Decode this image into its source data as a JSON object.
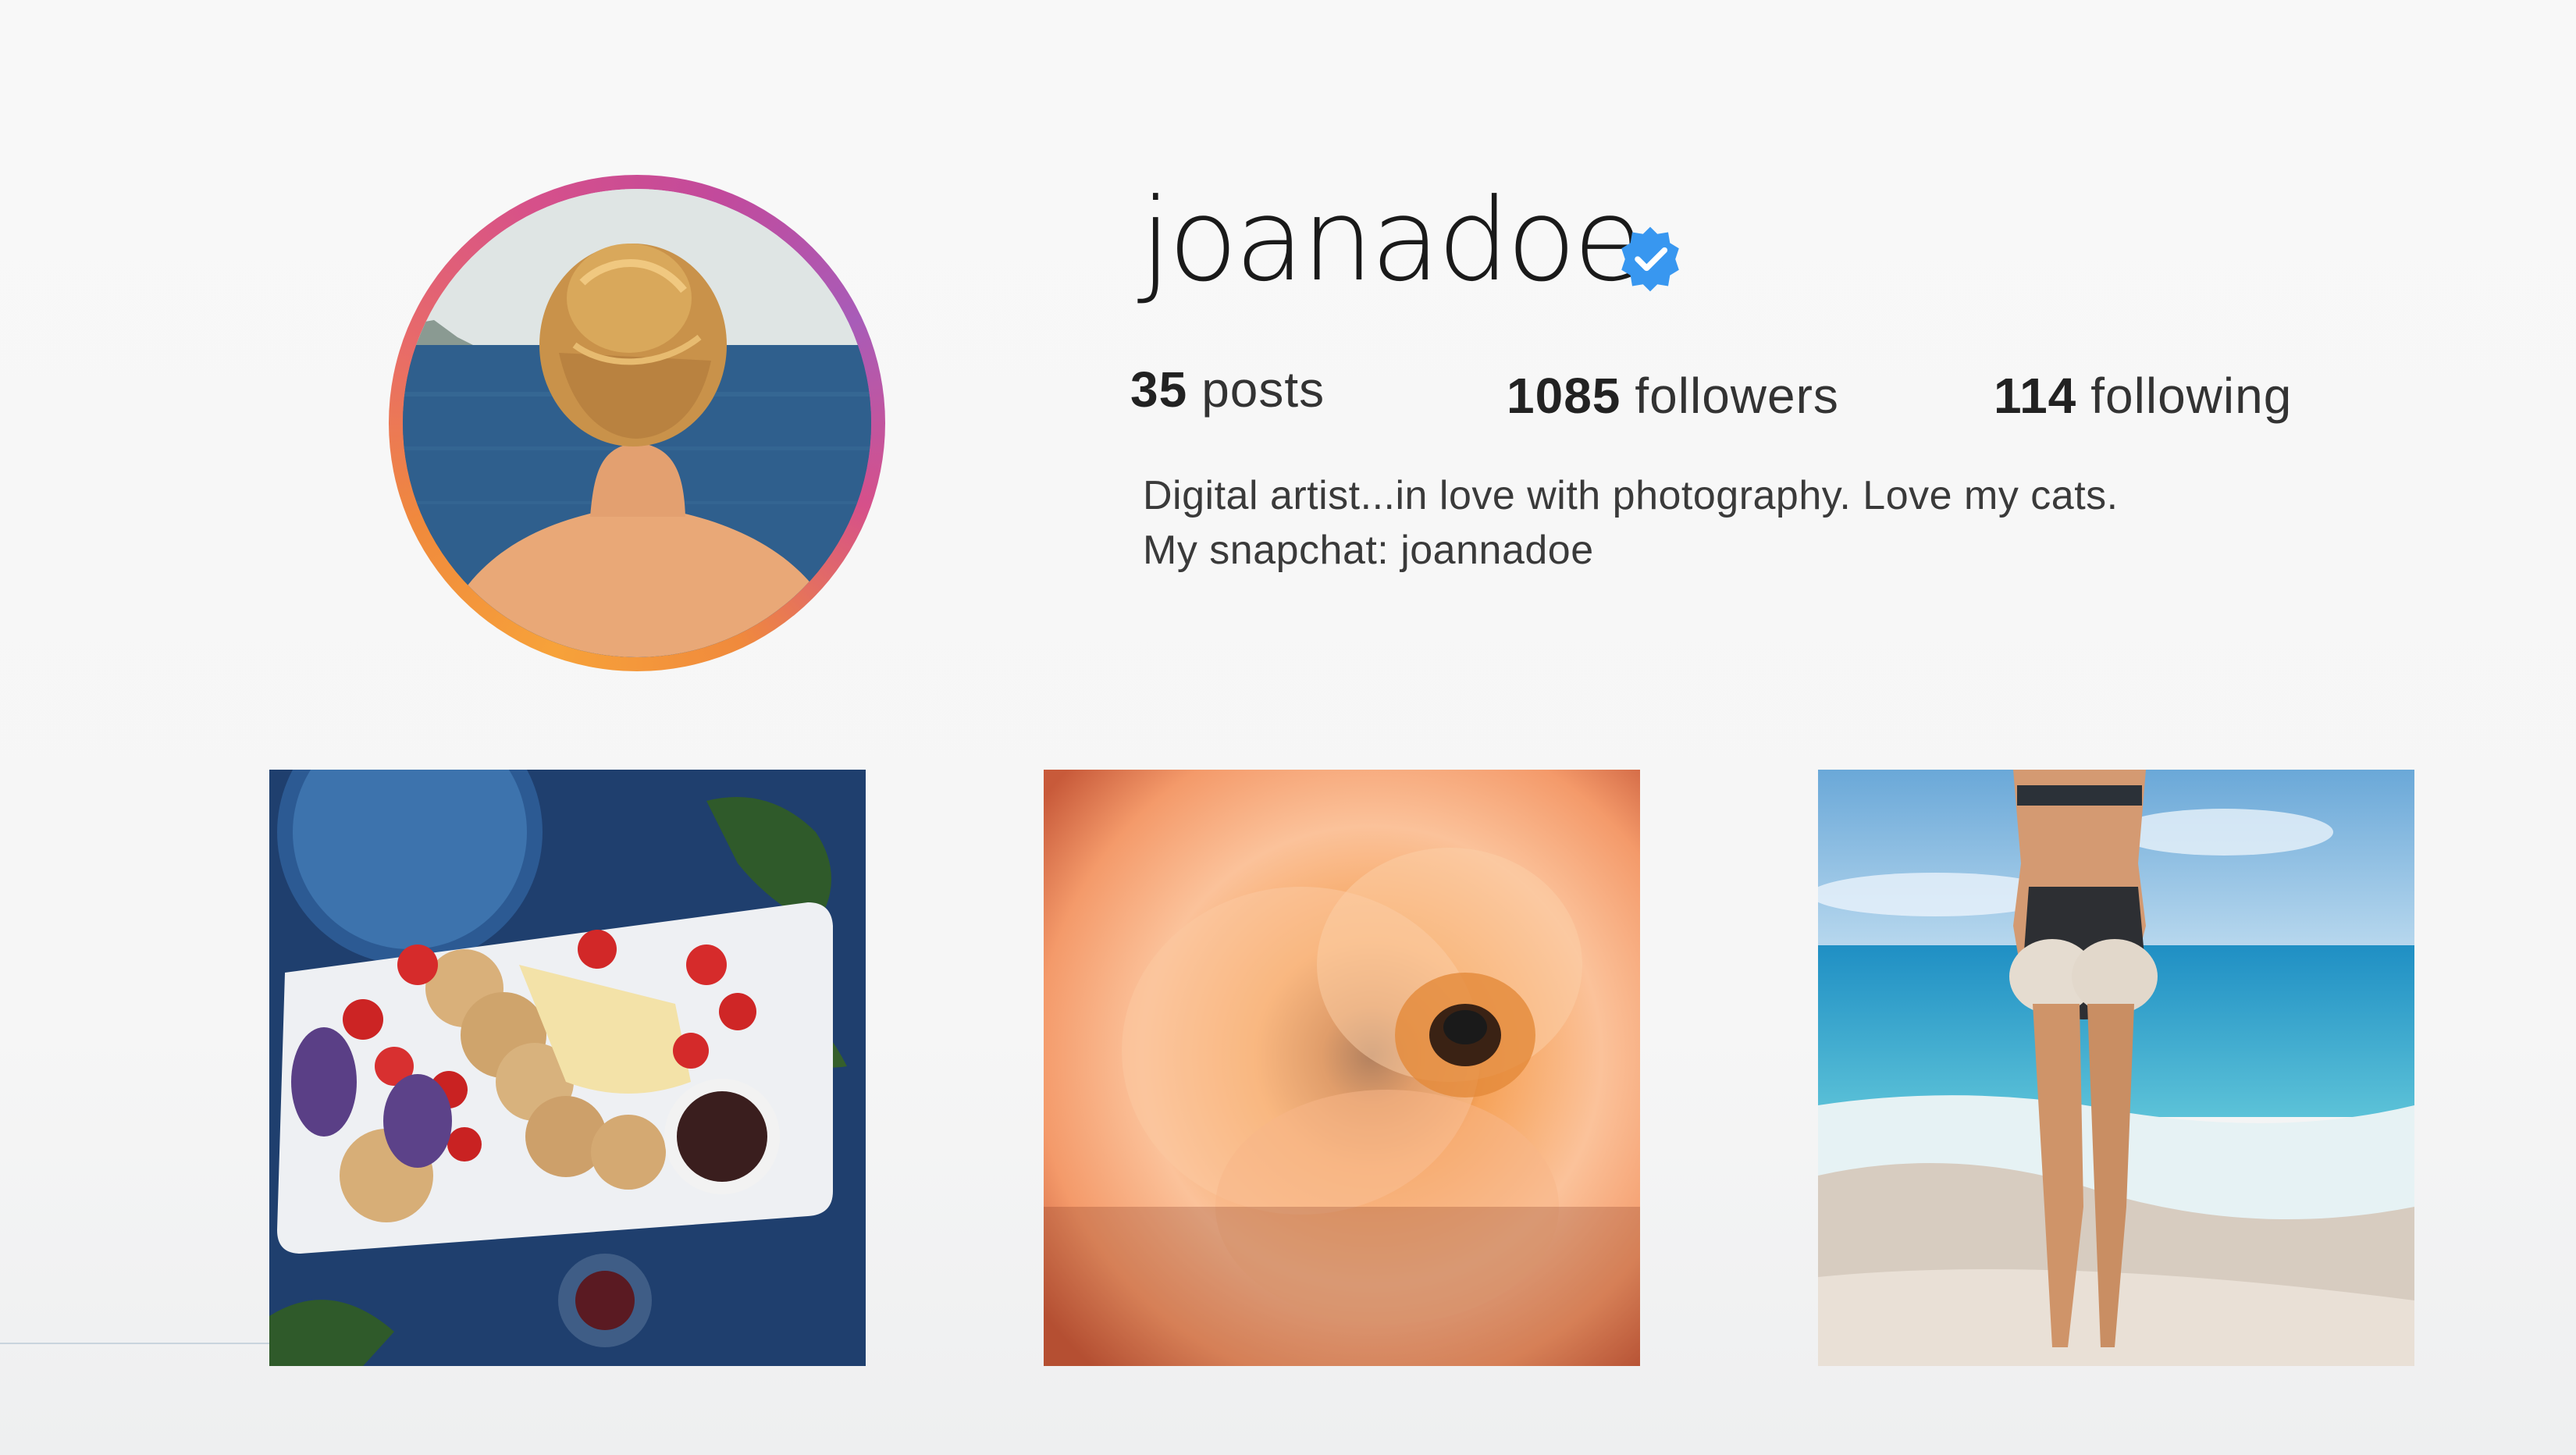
{
  "profile": {
    "username": "joanadoe",
    "verified_icon": "verified-badge-icon",
    "accent_color": "#3897f0",
    "ring_gradient": [
      "#f7a23a",
      "#e86a6a",
      "#c24a9c"
    ],
    "avatar_alt": "avatar photo"
  },
  "stats": {
    "posts_count": "35",
    "posts_label": "posts",
    "followers_count": "1085",
    "followers_label": "followers",
    "following_count": "114",
    "following_label": "following"
  },
  "bio": {
    "line1": "Digital artist...in love with photography. Love my cats.",
    "line2": "My snapchat: joannadoe"
  },
  "posts": [
    {
      "subject": "food platter"
    },
    {
      "subject": "peach rose with bee"
    },
    {
      "subject": "woman on beach"
    }
  ]
}
